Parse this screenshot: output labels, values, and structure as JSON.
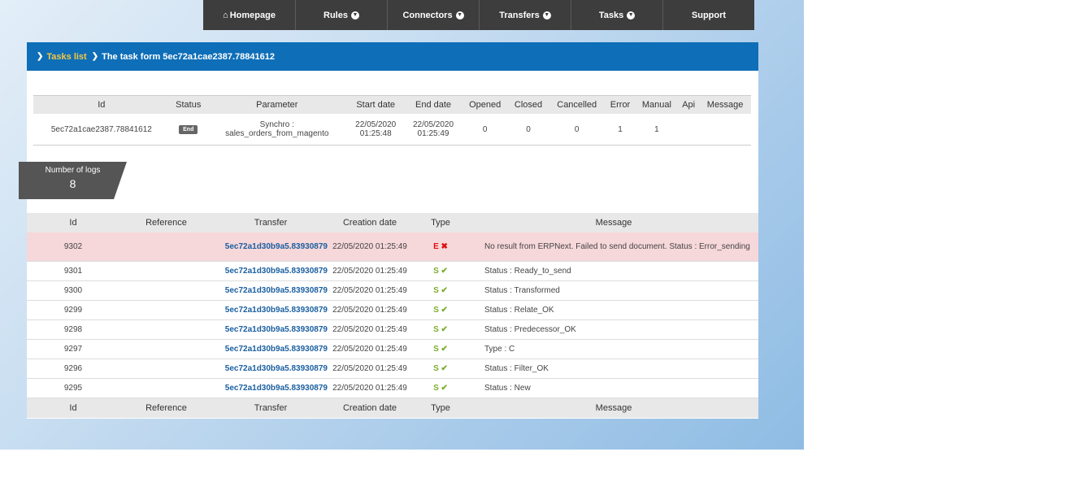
{
  "nav": [
    {
      "label": "Homepage",
      "icon": "home-icon",
      "dropdown": false
    },
    {
      "label": "Rules",
      "dropdown": true
    },
    {
      "label": "Connectors",
      "dropdown": true
    },
    {
      "label": "Transfers",
      "dropdown": true
    },
    {
      "label": "Tasks",
      "dropdown": true
    },
    {
      "label": "Support",
      "dropdown": false
    }
  ],
  "breadcrumb": {
    "link": "Tasks list",
    "current": "The task form 5ec72a1cae2387.78841612"
  },
  "task_table": {
    "headers": [
      "Id",
      "Status",
      "Parameter",
      "Start date",
      "End date",
      "Opened",
      "Closed",
      "Cancelled",
      "Error",
      "Manual",
      "Api",
      "Message"
    ],
    "row": {
      "id": "5ec72a1cae2387.78841612",
      "status": "End",
      "parameter_line1": "Synchro :",
      "parameter_line2": "sales_orders_from_magento",
      "start_date": "22/05/2020",
      "start_time": "01:25:48",
      "end_date": "22/05/2020",
      "end_time": "01:25:49",
      "opened": "0",
      "closed": "0",
      "cancelled": "0",
      "error": "1",
      "manual": "1",
      "api": "",
      "message": ""
    }
  },
  "logs_count": {
    "label": "Number of logs",
    "value": "8"
  },
  "log_table": {
    "headers": [
      "Id",
      "Reference",
      "Transfer",
      "Creation date",
      "Type",
      "Message"
    ],
    "rows": [
      {
        "id": "9302",
        "reference": "",
        "transfer": "5ec72a1d30b9a5.83930879",
        "date": "22/05/2020 01:25:49",
        "type": "E",
        "message": "No result from ERPNext. Failed to send document. Status : Error_sending",
        "error": true
      },
      {
        "id": "9301",
        "reference": "",
        "transfer": "5ec72a1d30b9a5.83930879",
        "date": "22/05/2020 01:25:49",
        "type": "S",
        "message": "Status : Ready_to_send",
        "error": false
      },
      {
        "id": "9300",
        "reference": "",
        "transfer": "5ec72a1d30b9a5.83930879",
        "date": "22/05/2020 01:25:49",
        "type": "S",
        "message": "Status : Transformed",
        "error": false
      },
      {
        "id": "9299",
        "reference": "",
        "transfer": "5ec72a1d30b9a5.83930879",
        "date": "22/05/2020 01:25:49",
        "type": "S",
        "message": "Status : Relate_OK",
        "error": false
      },
      {
        "id": "9298",
        "reference": "",
        "transfer": "5ec72a1d30b9a5.83930879",
        "date": "22/05/2020 01:25:49",
        "type": "S",
        "message": "Status : Predecessor_OK",
        "error": false
      },
      {
        "id": "9297",
        "reference": "",
        "transfer": "5ec72a1d30b9a5.83930879",
        "date": "22/05/2020 01:25:49",
        "type": "S",
        "message": "Type : C",
        "error": false
      },
      {
        "id": "9296",
        "reference": "",
        "transfer": "5ec72a1d30b9a5.83930879",
        "date": "22/05/2020 01:25:49",
        "type": "S",
        "message": "Status : Filter_OK",
        "error": false
      },
      {
        "id": "9295",
        "reference": "",
        "transfer": "5ec72a1d30b9a5.83930879",
        "date": "22/05/2020 01:25:49",
        "type": "S",
        "message": "Status : New",
        "error": false
      }
    ]
  },
  "colors": {
    "nav": "#3d3d3d",
    "breadcrumb": "#0e6eb8",
    "link": "#f5c842",
    "transfer": "#1a5fa0",
    "success": "#7cad2c",
    "error": "#dd1111",
    "error_row": "#f6d7da"
  }
}
